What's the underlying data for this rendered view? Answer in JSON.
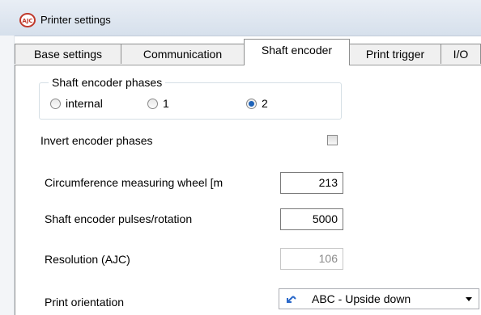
{
  "window": {
    "title": "Printer settings",
    "app_icon": "ajc-logo-icon"
  },
  "tabs": [
    {
      "label": "Base settings",
      "active": false
    },
    {
      "label": "Communication",
      "active": false
    },
    {
      "label": "Shaft encoder",
      "active": true
    },
    {
      "label": "Print trigger",
      "active": false
    },
    {
      "label": "I/O",
      "active": false
    }
  ],
  "phases": {
    "legend": "Shaft encoder phases",
    "options": [
      {
        "label": "internal",
        "checked": false
      },
      {
        "label": "1",
        "checked": false
      },
      {
        "label": "2",
        "checked": true
      }
    ]
  },
  "invert": {
    "label": "Invert encoder phases",
    "checked": false
  },
  "fields": {
    "circumference": {
      "label": "Circumference measuring wheel [m",
      "value": "213"
    },
    "pulses": {
      "label": "Shaft encoder pulses/rotation",
      "value": "5000"
    },
    "resolution": {
      "label": "Resolution (AJC)",
      "value": "106",
      "disabled": true
    }
  },
  "orientation": {
    "label": "Print orientation",
    "selected": "ABC - Upside down",
    "icon": "rotate-arrow-icon"
  },
  "colors": {
    "radio_checked": "#1f63b8",
    "titlebar": "#dce5f0"
  }
}
